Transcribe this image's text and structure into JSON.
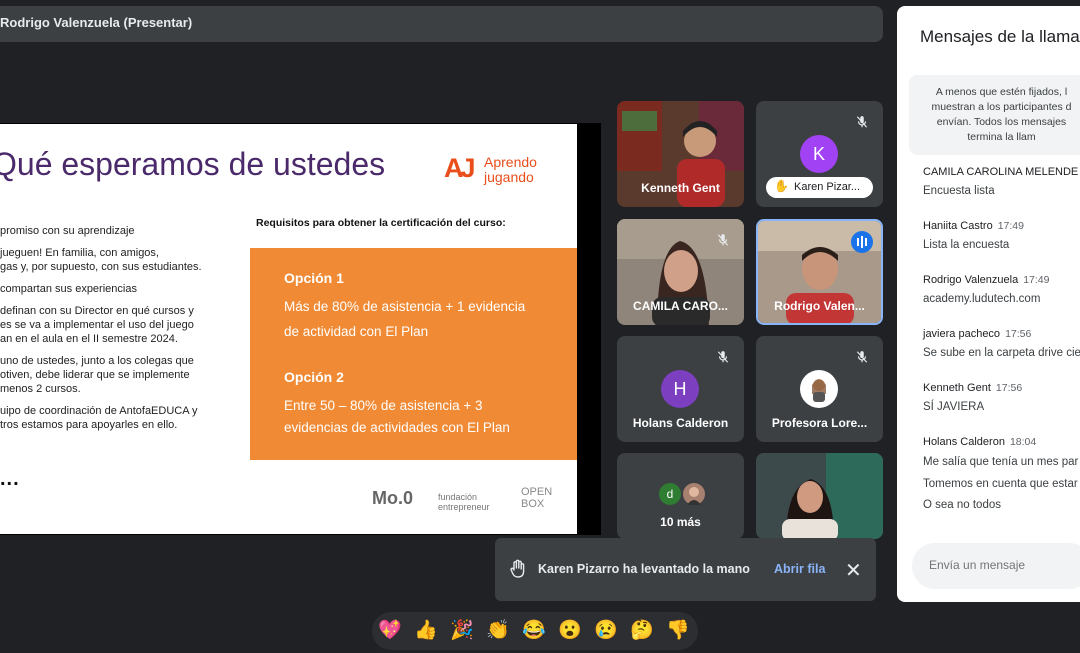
{
  "presenter_bar": {
    "label": "Rodrigo Valenzuela (Presentar)"
  },
  "slide": {
    "title": "Qué esperamos de ustedes",
    "logo_words": [
      "Aprendo",
      "jugando"
    ],
    "left_items": [
      "promiso con su aprendizaje",
      " jueguen! En familia, con amigos,\ngas y, por supuesto, con sus estudiantes.",
      " compartan sus experiencias",
      " definan con su Director en qué cursos y\nes se va a implementar el uso del juego\nan en el aula en el II semestre 2024.",
      " uno de ustedes, junto a los colegas que\notiven, debe liderar que se implemente\n menos 2 cursos.",
      "uipo de coordinación de AntofaEDUCA y\ntros estamos para apoyarles en ello."
    ],
    "requirements_title": "Requisitos para obtener la certificación del curso:",
    "option1": {
      "heading": "Opción 1",
      "lines": [
        "Más de 80% de asistencia + 1 evidencia",
        "de actividad con El Plan"
      ]
    },
    "option2": {
      "heading": "Opción 2",
      "lines": [
        "Entre 50 – 80% de asistencia + 3",
        "evidencias de actividades con El Plan"
      ]
    },
    "dots": "...",
    "footer_logos": [
      "Mo.0",
      "fundación entrepreneur",
      "OPEN BOX"
    ]
  },
  "participants": [
    {
      "name": "Kenneth Gent",
      "video": true
    },
    {
      "name": "Karen Pizar...",
      "initial": "K",
      "color": "#a142f4",
      "hand_raised": true,
      "muted": true
    },
    {
      "name": "CAMILA CARO...",
      "video": true,
      "muted": true
    },
    {
      "name": "Rodrigo Valen...",
      "video": true,
      "speaking": true
    },
    {
      "name": "Holans Calderon",
      "initial": "H",
      "color": "#7b3fbf",
      "muted": true
    },
    {
      "name": "Profesora Lore...",
      "muted": true
    },
    {
      "name": "10 más",
      "initial": "d",
      "color": "#2e7d32"
    },
    {
      "name": "",
      "video": true
    }
  ],
  "chat": {
    "title": "Mensajes de la llamada",
    "info": "A menos que estén fijados, l\nmuestran a los participantes d\nenvían. Todos los mensajes\ntermina la llam",
    "messages": [
      {
        "sender": "CAMILA CAROLINA MELENDE",
        "time": "",
        "lines": [
          "Encuesta lista"
        ]
      },
      {
        "sender": "Haniita Castro",
        "time": "17:49",
        "lines": [
          "Lista la encuesta"
        ]
      },
      {
        "sender": "Rodrigo Valenzuela",
        "time": "17:49",
        "lines": [
          "academy.ludutech.com"
        ]
      },
      {
        "sender": "javiera pacheco",
        "time": "17:56",
        "lines": [
          "Se sube en la carpeta drive cie"
        ]
      },
      {
        "sender": "Kenneth Gent",
        "time": "17:56",
        "lines": [
          "SÍ JAVIERA"
        ]
      },
      {
        "sender": "Holans Calderon",
        "time": "18:04",
        "lines": [
          "Me salía que tenía un mes par",
          "Tomemos en cuenta que estar",
          "O sea no todos"
        ]
      }
    ],
    "input_placeholder": "Envía un mensaje"
  },
  "toast": {
    "text": "Karen Pizarro ha levantado la mano",
    "action": "Abrir fila"
  },
  "reactions": [
    "💖",
    "👍",
    "🎉",
    "👏",
    "😂",
    "😮",
    "😢",
    "🤔",
    "👎"
  ]
}
